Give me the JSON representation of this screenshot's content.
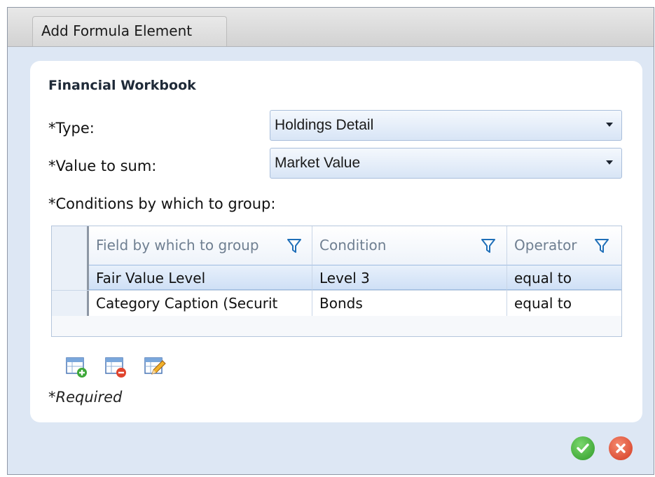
{
  "window": {
    "title": "Add Formula Element"
  },
  "panel": {
    "section_title": "Financial Workbook",
    "type_label": "*Type:",
    "type_value": "Holdings Detail",
    "value_to_sum_label": "*Value to sum:",
    "value_to_sum_value": "Market Value",
    "conditions_label": "*Conditions by which to group:",
    "grid": {
      "columns": [
        "Field by which to group",
        "Condition",
        "Operator"
      ],
      "rows": [
        [
          "Fair Value Level",
          "Level 3",
          "equal to"
        ],
        [
          "Category Caption (Securit",
          "Bonds",
          "equal to"
        ]
      ],
      "selected_row": 0
    },
    "required_note": "*Required"
  },
  "icons": {
    "add_row": "table-add-icon",
    "delete_row": "table-delete-icon",
    "edit_row": "table-edit-icon",
    "filter": "filter-icon",
    "ok": "check-icon",
    "cancel": "close-icon"
  },
  "colors": {
    "ok": "#3fb536",
    "cancel": "#e0442e",
    "selection": "#cfe0f6"
  }
}
